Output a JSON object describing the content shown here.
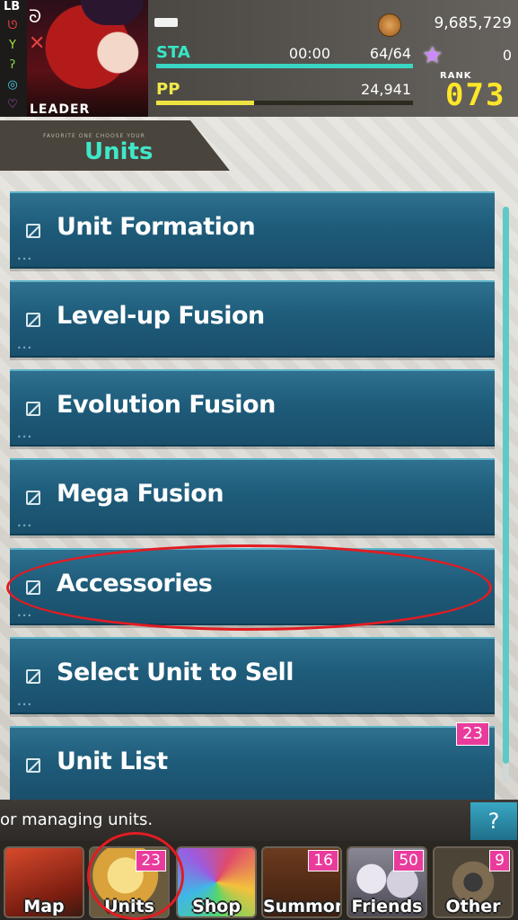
{
  "header": {
    "lb_label": "LB",
    "leader_label": "LEADER",
    "coins": "9,685,729",
    "sta_label": "STA",
    "sta_time": "00:00",
    "sta_value": "64/64",
    "sta_fraction": 1.0,
    "gems": "0",
    "pp_label": "PP",
    "pp_value": "24,941",
    "pp_fraction": 0.38,
    "rank_label": "RANK",
    "rank_value": "073"
  },
  "page": {
    "title_sub": "FAVORITE ONE CHOOSE YOUR",
    "title": "Units"
  },
  "menu": {
    "items": [
      {
        "label": "Unit Formation"
      },
      {
        "label": "Level-up Fusion"
      },
      {
        "label": "Evolution Fusion"
      },
      {
        "label": "Mega Fusion"
      },
      {
        "label": "Accessories"
      },
      {
        "label": "Select Unit to Sell"
      },
      {
        "label": "Unit List",
        "badge": "23"
      }
    ]
  },
  "info": {
    "text": "or managing units.",
    "help_label": "?"
  },
  "nav": {
    "items": [
      {
        "label": "Map",
        "badge": ""
      },
      {
        "label": "Units",
        "badge": "23"
      },
      {
        "label": "Shop",
        "badge": ""
      },
      {
        "label": "Summon",
        "badge": "16"
      },
      {
        "label": "Friends",
        "badge": "50"
      },
      {
        "label": "Other",
        "badge": "9"
      }
    ]
  },
  "colors": {
    "accent_teal": "#3fe7c9",
    "badge_pink": "#e93b9c",
    "highlight_red": "#e21c22",
    "rank_yellow": "#ffe629"
  }
}
